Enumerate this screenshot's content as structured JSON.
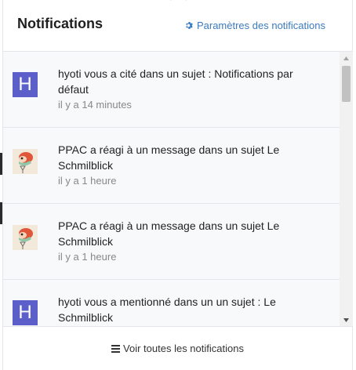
{
  "header": {
    "title": "Notifications",
    "settings_label": "Paramètres des notifications",
    "settings_icon": "gear-icon"
  },
  "notifications": [
    {
      "avatar": "H",
      "avatar_color": "#5c5fc9",
      "message": "hyoti vous a cité dans un sujet : Notifications par défaut",
      "time": "il y a 14 minutes"
    },
    {
      "avatar": "ppac-avatar-image",
      "message": "PPAC a réagi à un message dans un sujet Le Schmilblick",
      "time": "il y a 1 heure"
    },
    {
      "avatar": "ppac-avatar-image",
      "message": "PPAC a réagi à un message dans un sujet Le Schmilblick",
      "time": "il y a 1 heure"
    },
    {
      "avatar": "H",
      "avatar_color": "#5c5fc9",
      "message": "hyoti vous a mentionné dans un un sujet : Le Schmilblick",
      "time": ""
    }
  ],
  "footer": {
    "view_all_label": "Voir toutes les notifications",
    "view_all_icon": "list-icon"
  },
  "colors": {
    "accent": "#3b7bbf",
    "avatar_h": "#5c5fc9"
  }
}
